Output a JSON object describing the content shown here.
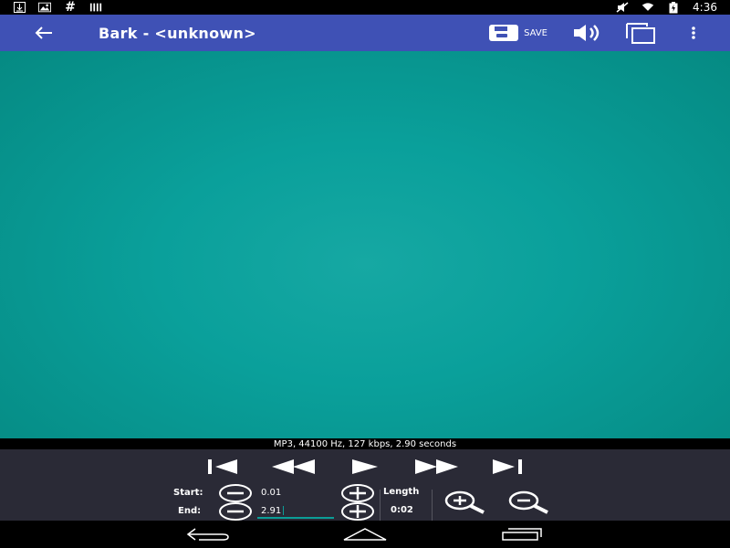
{
  "status_bar": {
    "left_icons": [
      "download-icon",
      "image-icon",
      "hash-icon",
      "signal-bars-icon"
    ],
    "right_icons": [
      "mute-icon",
      "wifi-icon",
      "battery-charging-icon"
    ],
    "time": "4:36"
  },
  "app_bar": {
    "title": "Bark - <unknown>",
    "save_label": "SAVE",
    "color": "#3f51b5"
  },
  "waveform": {
    "background_color": "#0aa09b"
  },
  "file_info": "MP3, 44100 Hz, 127 kbps, 2.90 seconds",
  "transport": {
    "buttons": [
      "skip-start-icon",
      "rewind-icon",
      "play-icon",
      "fast-forward-icon",
      "skip-end-icon"
    ]
  },
  "markers": {
    "start_label": "Start:",
    "start_value": "0.01",
    "end_label": "End:",
    "end_value": "2.91",
    "length_label": "Length",
    "length_value": "0:02"
  },
  "nav_bar": {
    "buttons": [
      "back-nav-icon",
      "home-nav-icon",
      "recents-nav-icon"
    ]
  }
}
